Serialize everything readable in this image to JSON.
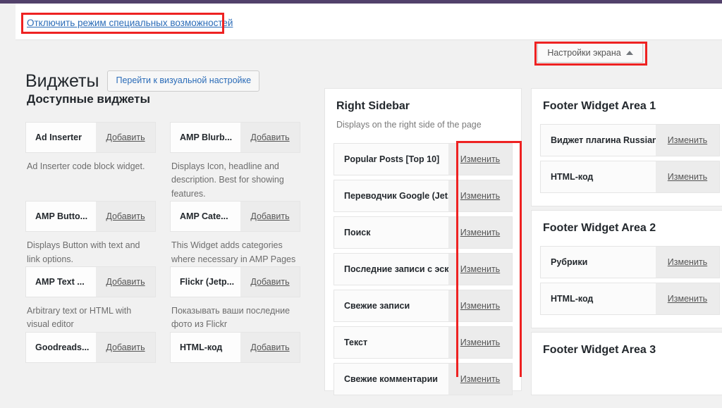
{
  "colors": {
    "adminbar": "#52416b",
    "highlight": "#ee2222",
    "link": "#2b6cb8",
    "background": "#f1f1f1"
  },
  "notice": {
    "link_label": "Отключить режим специальных возможностей"
  },
  "screen_options": {
    "label": "Настройки экрана",
    "caret": "caret-up-icon"
  },
  "header": {
    "title": "Виджеты",
    "customize_button": "Перейти к визуальной настройке"
  },
  "available_widgets": {
    "heading": "Доступные виджеты",
    "add_label": "Добавить",
    "items": [
      {
        "name": "Ad Inserter",
        "desc": "Ad Inserter code block widget."
      },
      {
        "name": "AMP Blurb...",
        "desc": "Displays Icon, headline and description. Best for showing features."
      },
      {
        "name": "AMP Butto...",
        "desc": "Displays Button with text and link options."
      },
      {
        "name": "AMP Cate...",
        "desc": "This Widget adds categories where necessary in AMP Pages"
      },
      {
        "name": "AMP Text ...",
        "desc": "Arbitrary text or HTML with visual editor"
      },
      {
        "name": "Flickr (Jetp...",
        "desc": "Показывать ваши последние фото из Flickr"
      },
      {
        "name": "Goodreads...",
        "desc": ""
      },
      {
        "name": "HTML-код",
        "desc": ""
      }
    ]
  },
  "edit_label": "Изменить",
  "sidebars": {
    "right_sidebar": {
      "title": "Right Sidebar",
      "description": "Displays on the right side of the page",
      "widgets": [
        "Popular Posts [Top 10]",
        "Переводчик Google (Jet...",
        "Поиск",
        "Последние записи с эск...",
        "Свежие записи",
        "Текст",
        "Свежие комментарии"
      ]
    },
    "footer_1": {
      "title": "Footer Widget Area 1",
      "widgets": [
        "Виджет плагина Russian...",
        "HTML-код"
      ]
    },
    "footer_2": {
      "title": "Footer Widget Area 2",
      "widgets": [
        "Рубрики",
        "HTML-код"
      ]
    },
    "footer_3": {
      "title": "Footer Widget Area 3",
      "widgets": []
    }
  }
}
